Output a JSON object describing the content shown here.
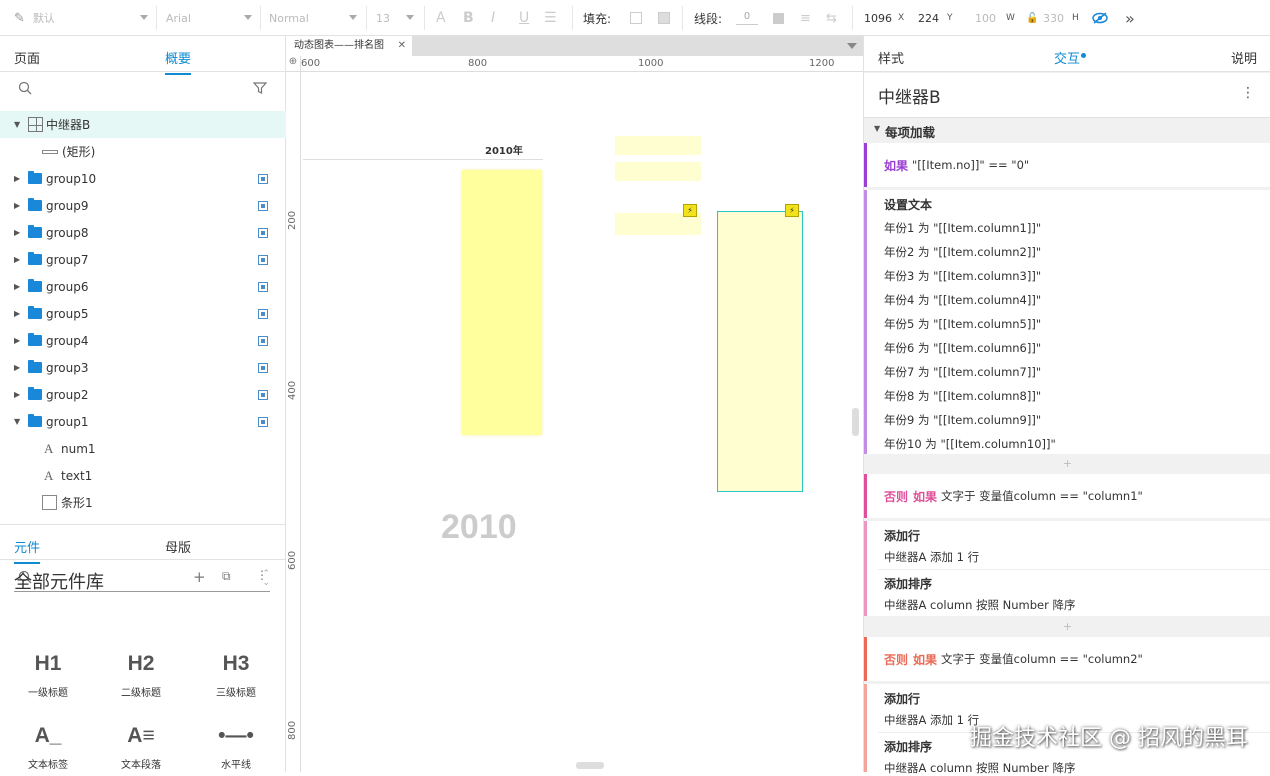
{
  "toolbar": {
    "style_value": "默认",
    "font_value": "Arial",
    "weight_value": "Normal",
    "size_value": "13",
    "fill_label": "填充:",
    "stroke_label": "线段:",
    "stroke_value": "0",
    "x_value": "1096",
    "x_label": "X",
    "y_value": "224",
    "y_label": "Y",
    "w_value": "100",
    "w_label": "W",
    "h_value": "330",
    "h_label": "H"
  },
  "left_panel": {
    "tabs": [
      "页面",
      "概要"
    ],
    "active_tab": 1,
    "tree": [
      {
        "label": "中继器B",
        "level": 0,
        "type": "repeater",
        "expanded": true,
        "selected": true
      },
      {
        "label": "(矩形)",
        "level": 1,
        "type": "rect"
      },
      {
        "label": "group10",
        "level": 0,
        "type": "folder"
      },
      {
        "label": "group9",
        "level": 0,
        "type": "folder"
      },
      {
        "label": "group8",
        "level": 0,
        "type": "folder"
      },
      {
        "label": "group7",
        "level": 0,
        "type": "folder"
      },
      {
        "label": "group6",
        "level": 0,
        "type": "folder"
      },
      {
        "label": "group5",
        "level": 0,
        "type": "folder"
      },
      {
        "label": "group4",
        "level": 0,
        "type": "folder"
      },
      {
        "label": "group3",
        "level": 0,
        "type": "folder"
      },
      {
        "label": "group2",
        "level": 0,
        "type": "folder"
      },
      {
        "label": "group1",
        "level": 0,
        "type": "folder",
        "expanded": true
      },
      {
        "label": "num1",
        "level": 1,
        "type": "text"
      },
      {
        "label": "text1",
        "level": 1,
        "type": "text"
      },
      {
        "label": "条形1",
        "level": 1,
        "type": "box"
      }
    ],
    "lib_tabs": [
      "元件",
      "母版"
    ],
    "lib_title": "全部元件库",
    "widgets": [
      {
        "big": "H1",
        "cap": "一级标题"
      },
      {
        "big": "H2",
        "cap": "二级标题"
      },
      {
        "big": "H3",
        "cap": "三级标题"
      },
      {
        "big": "A_",
        "cap": "文本标签"
      },
      {
        "big": "A≡",
        "cap": "文本段落"
      },
      {
        "big": "•—•",
        "cap": "水平线"
      }
    ]
  },
  "canvas": {
    "tab_title": "动态图表——排名图",
    "ruler_h": [
      "600",
      "800",
      "1000",
      "1200"
    ],
    "ruler_v": [
      "200",
      "400",
      "600",
      "800"
    ],
    "year_label": "2010年",
    "big_year": "2010"
  },
  "right_panel": {
    "tabs": [
      "样式",
      "交互",
      "说明"
    ],
    "active_tab": 1,
    "title": "中继器B",
    "section": "每项加载",
    "case1": {
      "keyword": "如果",
      "cond": "\"[[Item.no]]\" == \"0\"",
      "action_title": "设置文本",
      "lines": [
        "年份1 为 \"[[Item.column1]]\"",
        "年份2 为 \"[[Item.column2]]\"",
        "年份3 为 \"[[Item.column3]]\"",
        "年份4 为 \"[[Item.column4]]\"",
        "年份5 为 \"[[Item.column5]]\"",
        "年份6 为 \"[[Item.column6]]\"",
        "年份7 为 \"[[Item.column7]]\"",
        "年份8 为 \"[[Item.column8]]\"",
        "年份9 为 \"[[Item.column9]]\"",
        "年份10 为 \"[[Item.column10]]\""
      ]
    },
    "case2": {
      "keyword1": "否则",
      "keyword2": "如果",
      "cond": "文字于 变量值column == \"column1\"",
      "a1_title": "添加行",
      "a1_line": "中继器A 添加 1 行",
      "a2_title": "添加排序",
      "a2_line": "中继器A column 按照 Number 降序"
    },
    "case3": {
      "keyword1": "否则",
      "keyword2": "如果",
      "cond": "文字于 变量值column == \"column2\"",
      "a1_title": "添加行",
      "a1_line": "中继器A 添加 1 行",
      "a2_title": "添加排序",
      "a2_line": "中继器A column 按照 Number 降序"
    },
    "colors": {
      "case1": "#9b3fd4",
      "case2": "#e0509a",
      "case3": "#ea6a55"
    }
  },
  "watermark": "掘金技术社区 @ 招风的黑耳"
}
